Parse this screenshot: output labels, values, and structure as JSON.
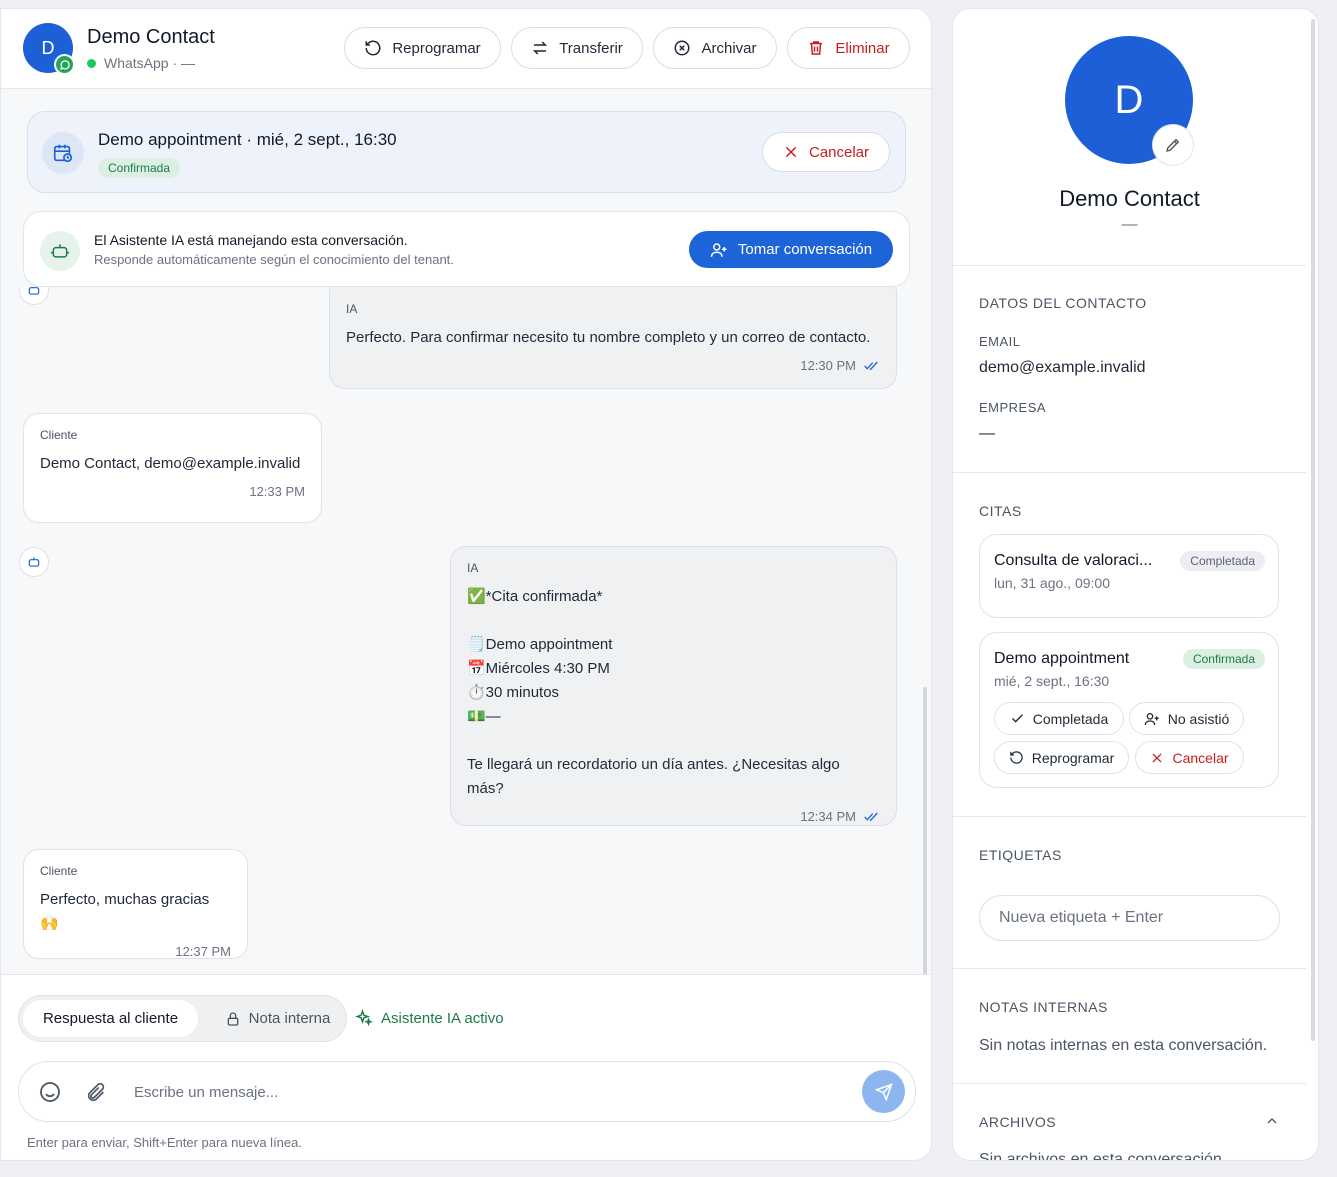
{
  "header": {
    "avatar_initial": "D",
    "contact_name": "Demo Contact",
    "channel": "WhatsApp · —",
    "buttons": {
      "reschedule": "Reprogramar",
      "transfer": "Transferir",
      "archive": "Archivar",
      "delete": "Eliminar"
    }
  },
  "appointment": {
    "title": "Demo appointment · mié, 2 sept., 16:30",
    "status": "Confirmada",
    "cancel_label": "Cancelar"
  },
  "ai_banner": {
    "title": "El Asistente IA está manejando esta conversación.",
    "subtitle": "Responde automáticamente según el conocimiento del tenant.",
    "take_label": "Tomar conversación"
  },
  "messages": [
    {
      "sender": "IA",
      "text": "Perfecto. Para confirmar necesito tu nombre completo y un correo de contacto.",
      "time": "12:30 PM"
    },
    {
      "sender": "Cliente",
      "text": "Demo Contact, demo@example.invalid",
      "time": "12:33 PM"
    },
    {
      "sender": "IA",
      "text": "✅*Cita confirmada*\n\n🗒️Demo appointment\n📅Miércoles 4:30 PM\n⏱️30 minutos\n💵—\n\nTe llegará un recordatorio un día antes. ¿Necesitas algo más?",
      "time": "12:34 PM"
    },
    {
      "sender": "Cliente",
      "text": "Perfecto, muchas gracias 🙌",
      "time": "12:37 PM"
    }
  ],
  "composer": {
    "tab_reply": "Respuesta al cliente",
    "tab_note": "Nota interna",
    "ai_active": "Asistente IA activo",
    "placeholder": "Escribe un mensaje...",
    "hint": "Enter para enviar, Shift+Enter para nueva línea."
  },
  "sidebar": {
    "avatar_initial": "D",
    "name": "Demo Contact",
    "subtitle": "—",
    "contact_section": "DATOS DEL CONTACTO",
    "email_label": "EMAIL",
    "email_value": "demo@example.invalid",
    "company_label": "EMPRESA",
    "company_value": "—",
    "citas_section": "CITAS",
    "citas": [
      {
        "title": "Consulta de valoraci...",
        "datetime": "lun, 31 ago., 09:00",
        "status": "Completada"
      },
      {
        "title": "Demo appointment",
        "datetime": "mié, 2 sept., 16:30",
        "status": "Confirmada"
      }
    ],
    "cita_actions": {
      "completed": "Completada",
      "no_show": "No asistió",
      "reschedule": "Reprogramar",
      "cancel": "Cancelar"
    },
    "tags_section": "ETIQUETAS",
    "tags_placeholder": "Nueva etiqueta + Enter",
    "notes_section": "NOTAS INTERNAS",
    "notes_empty": "Sin notas internas en esta conversación.",
    "files_section": "ARCHIVOS",
    "files_empty": "Sin archivos en esta conversación."
  },
  "colors": {
    "brand_blue": "#1d5fd6",
    "primary_button": "#1d64d8",
    "danger": "#c81e1e",
    "success": "#1e7b47",
    "whatsapp": "#25a45a"
  }
}
